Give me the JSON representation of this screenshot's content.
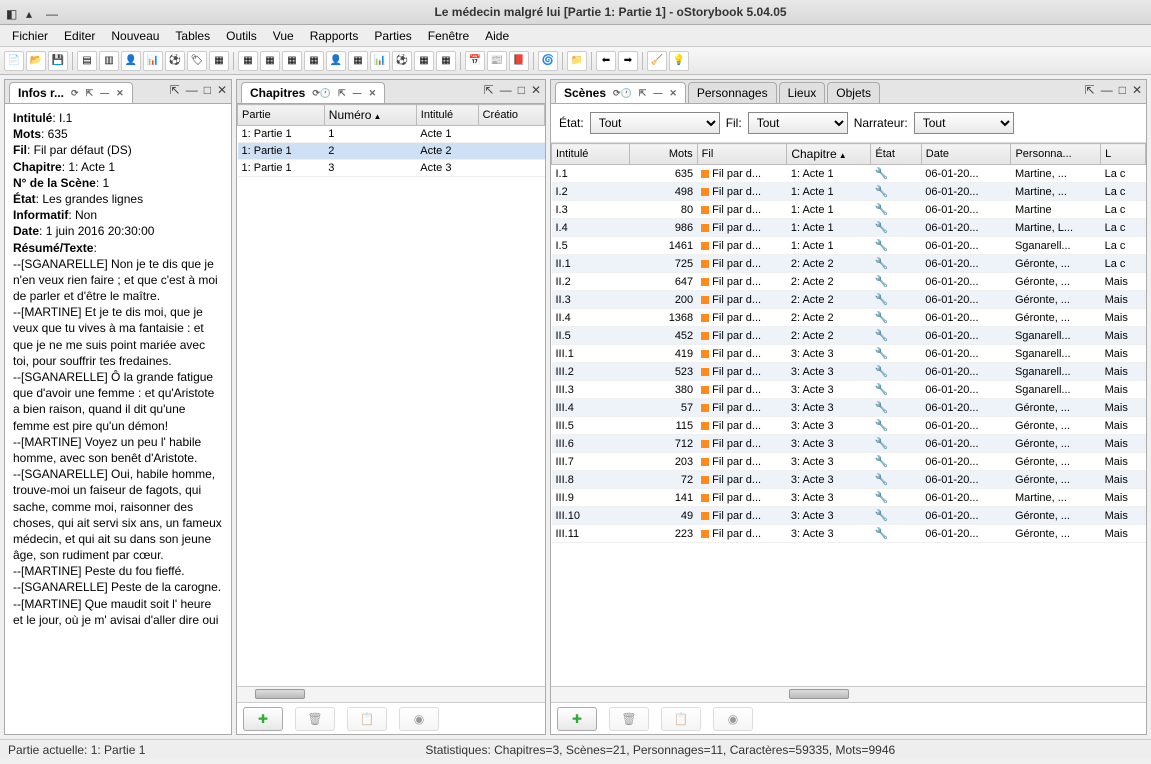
{
  "window": {
    "title": "Le médecin malgré lui [Partie 1: Partie 1] - oStorybook 5.04.05"
  },
  "menu": {
    "items": [
      "Fichier",
      "Editer",
      "Nouveau",
      "Tables",
      "Outils",
      "Vue",
      "Rapports",
      "Parties",
      "Fenêtre",
      "Aide"
    ]
  },
  "info_panel": {
    "tab": "Infos r...",
    "intitule_label": "Intitulé",
    "intitule_val": "I.1",
    "mots_label": "Mots",
    "mots_val": "635",
    "fil_label": "Fil",
    "fil_val": "Fil par défaut (DS)",
    "chapitre_label": "Chapitre",
    "chapitre_val": "1: Acte 1",
    "scene_no_label": "N° de la Scène",
    "scene_no_val": "1",
    "etat_label": "État",
    "etat_val": "Les grandes lignes",
    "informatif_label": "Informatif",
    "informatif_val": "Non",
    "date_label": "Date",
    "date_val": "1 juin 2016 20:30:00",
    "resume_label": "Résumé/Texte",
    "resume_text": "--[SGANARELLE] Non je te dis que je n'en veux rien faire ; et que c'est à moi de parler et d'être le maître.\n--[MARTINE] Et je te dis moi, que je veux que tu vives à ma fantaisie : et que je ne me suis point mariée avec toi, pour souffrir tes fredaines.\n--[SGANARELLE] Ô la grande fatigue que d'avoir une femme : et qu'Aristote a bien raison, quand il dit qu'une femme est pire qu'un démon!\n--[MARTINE] Voyez un peu l' habile homme, avec son benêt d'Aristote.\n--[SGANARELLE] Oui, habile homme, trouve-moi un faiseur de fagots, qui sache, comme moi, raisonner des choses, qui ait servi six ans, un fameux médecin, et qui ait su dans son jeune âge, son rudiment par cœur.\n--[MARTINE] Peste du fou fieffé.\n--[SGANARELLE] Peste de la carogne.\n--[MARTINE] Que maudit soit l' heure et le jour, où je m' avisai d'aller dire oui"
  },
  "chapitres": {
    "tab": "Chapitres",
    "headers": {
      "partie": "Partie",
      "numero": "Numéro",
      "intitule": "Intitulé",
      "creation": "Créatio"
    },
    "rows": [
      {
        "partie": "1: Partie 1",
        "numero": "1",
        "intitule": "Acte 1"
      },
      {
        "partie": "1: Partie 1",
        "numero": "2",
        "intitule": "Acte 2"
      },
      {
        "partie": "1: Partie 1",
        "numero": "3",
        "intitule": "Acte 3"
      }
    ]
  },
  "scenes": {
    "tab": "Scènes",
    "tabs_other": [
      "Personnages",
      "Lieux",
      "Objets"
    ],
    "filters": {
      "etat_label": "État:",
      "etat_val": "Tout",
      "fil_label": "Fil:",
      "fil_val": "Tout",
      "narr_label": "Narrateur:",
      "narr_val": "Tout"
    },
    "headers": {
      "intitule": "Intitulé",
      "mots": "Mots",
      "fil": "Fil",
      "chapitre": "Chapitre",
      "etat": "État",
      "date": "Date",
      "person": "Personna...",
      "lieu": "L"
    },
    "rows": [
      {
        "i": "I.1",
        "m": "635",
        "f": "Fil par d...",
        "c": "1: Acte 1",
        "d": "06-01-20...",
        "p": "Martine, ...",
        "l": "La c"
      },
      {
        "i": "I.2",
        "m": "498",
        "f": "Fil par d...",
        "c": "1: Acte 1",
        "d": "06-01-20...",
        "p": "Martine, ...",
        "l": "La c"
      },
      {
        "i": "I.3",
        "m": "80",
        "f": "Fil par d...",
        "c": "1: Acte 1",
        "d": "06-01-20...",
        "p": "Martine",
        "l": "La c"
      },
      {
        "i": "I.4",
        "m": "986",
        "f": "Fil par d...",
        "c": "1: Acte 1",
        "d": "06-01-20...",
        "p": "Martine, L...",
        "l": "La c"
      },
      {
        "i": "I.5",
        "m": "1461",
        "f": "Fil par d...",
        "c": "1: Acte 1",
        "d": "06-01-20...",
        "p": "Sganarell...",
        "l": "La c"
      },
      {
        "i": "II.1",
        "m": "725",
        "f": "Fil par d...",
        "c": "2: Acte 2",
        "d": "06-01-20...",
        "p": "Géronte, ...",
        "l": "La c"
      },
      {
        "i": "II.2",
        "m": "647",
        "f": "Fil par d...",
        "c": "2: Acte 2",
        "d": "06-01-20...",
        "p": "Géronte, ...",
        "l": "Mais"
      },
      {
        "i": "II.3",
        "m": "200",
        "f": "Fil par d...",
        "c": "2: Acte 2",
        "d": "06-01-20...",
        "p": "Géronte, ...",
        "l": "Mais"
      },
      {
        "i": "II.4",
        "m": "1368",
        "f": "Fil par d...",
        "c": "2: Acte 2",
        "d": "06-01-20...",
        "p": "Géronte, ...",
        "l": "Mais"
      },
      {
        "i": "II.5",
        "m": "452",
        "f": "Fil par d...",
        "c": "2: Acte 2",
        "d": "06-01-20...",
        "p": "Sganarell...",
        "l": "Mais"
      },
      {
        "i": "III.1",
        "m": "419",
        "f": "Fil par d...",
        "c": "3: Acte 3",
        "d": "06-01-20...",
        "p": "Sganarell...",
        "l": "Mais"
      },
      {
        "i": "III.2",
        "m": "523",
        "f": "Fil par d...",
        "c": "3: Acte 3",
        "d": "06-01-20...",
        "p": "Sganarell...",
        "l": "Mais"
      },
      {
        "i": "III.3",
        "m": "380",
        "f": "Fil par d...",
        "c": "3: Acte 3",
        "d": "06-01-20...",
        "p": "Sganarell...",
        "l": "Mais"
      },
      {
        "i": "III.4",
        "m": "57",
        "f": "Fil par d...",
        "c": "3: Acte 3",
        "d": "06-01-20...",
        "p": "Géronte, ...",
        "l": "Mais"
      },
      {
        "i": "III.5",
        "m": "115",
        "f": "Fil par d...",
        "c": "3: Acte 3",
        "d": "06-01-20...",
        "p": "Géronte, ...",
        "l": "Mais"
      },
      {
        "i": "III.6",
        "m": "712",
        "f": "Fil par d...",
        "c": "3: Acte 3",
        "d": "06-01-20...",
        "p": "Géronte, ...",
        "l": "Mais"
      },
      {
        "i": "III.7",
        "m": "203",
        "f": "Fil par d...",
        "c": "3: Acte 3",
        "d": "06-01-20...",
        "p": "Géronte, ...",
        "l": "Mais"
      },
      {
        "i": "III.8",
        "m": "72",
        "f": "Fil par d...",
        "c": "3: Acte 3",
        "d": "06-01-20...",
        "p": "Géronte, ...",
        "l": "Mais"
      },
      {
        "i": "III.9",
        "m": "141",
        "f": "Fil par d...",
        "c": "3: Acte 3",
        "d": "06-01-20...",
        "p": "Martine, ...",
        "l": "Mais"
      },
      {
        "i": "III.10",
        "m": "49",
        "f": "Fil par d...",
        "c": "3: Acte 3",
        "d": "06-01-20...",
        "p": "Géronte, ...",
        "l": "Mais"
      },
      {
        "i": "III.11",
        "m": "223",
        "f": "Fil par d...",
        "c": "3: Acte 3",
        "d": "06-01-20...",
        "p": "Géronte, ...",
        "l": "Mais"
      }
    ]
  },
  "statusbar": {
    "left": "Partie actuelle: 1: Partie 1",
    "right": "Statistiques: Chapitres=3,  Scènes=21,  Personnages=11,  Caractères=59335,  Mots=9946"
  }
}
